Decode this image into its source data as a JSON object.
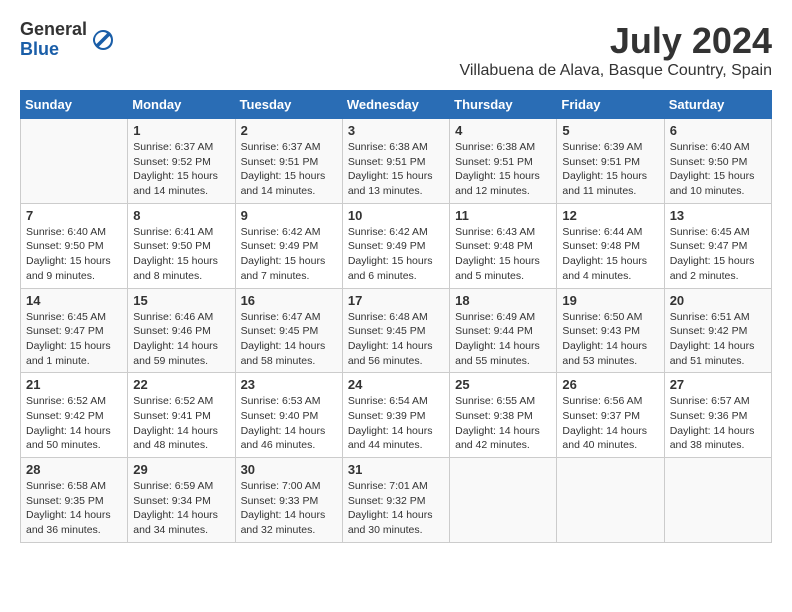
{
  "logo": {
    "general": "General",
    "blue": "Blue"
  },
  "title": "July 2024",
  "location": "Villabuena de Alava, Basque Country, Spain",
  "days_of_week": [
    "Sunday",
    "Monday",
    "Tuesday",
    "Wednesday",
    "Thursday",
    "Friday",
    "Saturday"
  ],
  "weeks": [
    [
      {
        "day": "",
        "info": ""
      },
      {
        "day": "1",
        "info": "Sunrise: 6:37 AM\nSunset: 9:52 PM\nDaylight: 15 hours\nand 14 minutes."
      },
      {
        "day": "2",
        "info": "Sunrise: 6:37 AM\nSunset: 9:51 PM\nDaylight: 15 hours\nand 14 minutes."
      },
      {
        "day": "3",
        "info": "Sunrise: 6:38 AM\nSunset: 9:51 PM\nDaylight: 15 hours\nand 13 minutes."
      },
      {
        "day": "4",
        "info": "Sunrise: 6:38 AM\nSunset: 9:51 PM\nDaylight: 15 hours\nand 12 minutes."
      },
      {
        "day": "5",
        "info": "Sunrise: 6:39 AM\nSunset: 9:51 PM\nDaylight: 15 hours\nand 11 minutes."
      },
      {
        "day": "6",
        "info": "Sunrise: 6:40 AM\nSunset: 9:50 PM\nDaylight: 15 hours\nand 10 minutes."
      }
    ],
    [
      {
        "day": "7",
        "info": "Sunrise: 6:40 AM\nSunset: 9:50 PM\nDaylight: 15 hours\nand 9 minutes."
      },
      {
        "day": "8",
        "info": "Sunrise: 6:41 AM\nSunset: 9:50 PM\nDaylight: 15 hours\nand 8 minutes."
      },
      {
        "day": "9",
        "info": "Sunrise: 6:42 AM\nSunset: 9:49 PM\nDaylight: 15 hours\nand 7 minutes."
      },
      {
        "day": "10",
        "info": "Sunrise: 6:42 AM\nSunset: 9:49 PM\nDaylight: 15 hours\nand 6 minutes."
      },
      {
        "day": "11",
        "info": "Sunrise: 6:43 AM\nSunset: 9:48 PM\nDaylight: 15 hours\nand 5 minutes."
      },
      {
        "day": "12",
        "info": "Sunrise: 6:44 AM\nSunset: 9:48 PM\nDaylight: 15 hours\nand 4 minutes."
      },
      {
        "day": "13",
        "info": "Sunrise: 6:45 AM\nSunset: 9:47 PM\nDaylight: 15 hours\nand 2 minutes."
      }
    ],
    [
      {
        "day": "14",
        "info": "Sunrise: 6:45 AM\nSunset: 9:47 PM\nDaylight: 15 hours\nand 1 minute."
      },
      {
        "day": "15",
        "info": "Sunrise: 6:46 AM\nSunset: 9:46 PM\nDaylight: 14 hours\nand 59 minutes."
      },
      {
        "day": "16",
        "info": "Sunrise: 6:47 AM\nSunset: 9:45 PM\nDaylight: 14 hours\nand 58 minutes."
      },
      {
        "day": "17",
        "info": "Sunrise: 6:48 AM\nSunset: 9:45 PM\nDaylight: 14 hours\nand 56 minutes."
      },
      {
        "day": "18",
        "info": "Sunrise: 6:49 AM\nSunset: 9:44 PM\nDaylight: 14 hours\nand 55 minutes."
      },
      {
        "day": "19",
        "info": "Sunrise: 6:50 AM\nSunset: 9:43 PM\nDaylight: 14 hours\nand 53 minutes."
      },
      {
        "day": "20",
        "info": "Sunrise: 6:51 AM\nSunset: 9:42 PM\nDaylight: 14 hours\nand 51 minutes."
      }
    ],
    [
      {
        "day": "21",
        "info": "Sunrise: 6:52 AM\nSunset: 9:42 PM\nDaylight: 14 hours\nand 50 minutes."
      },
      {
        "day": "22",
        "info": "Sunrise: 6:52 AM\nSunset: 9:41 PM\nDaylight: 14 hours\nand 48 minutes."
      },
      {
        "day": "23",
        "info": "Sunrise: 6:53 AM\nSunset: 9:40 PM\nDaylight: 14 hours\nand 46 minutes."
      },
      {
        "day": "24",
        "info": "Sunrise: 6:54 AM\nSunset: 9:39 PM\nDaylight: 14 hours\nand 44 minutes."
      },
      {
        "day": "25",
        "info": "Sunrise: 6:55 AM\nSunset: 9:38 PM\nDaylight: 14 hours\nand 42 minutes."
      },
      {
        "day": "26",
        "info": "Sunrise: 6:56 AM\nSunset: 9:37 PM\nDaylight: 14 hours\nand 40 minutes."
      },
      {
        "day": "27",
        "info": "Sunrise: 6:57 AM\nSunset: 9:36 PM\nDaylight: 14 hours\nand 38 minutes."
      }
    ],
    [
      {
        "day": "28",
        "info": "Sunrise: 6:58 AM\nSunset: 9:35 PM\nDaylight: 14 hours\nand 36 minutes."
      },
      {
        "day": "29",
        "info": "Sunrise: 6:59 AM\nSunset: 9:34 PM\nDaylight: 14 hours\nand 34 minutes."
      },
      {
        "day": "30",
        "info": "Sunrise: 7:00 AM\nSunset: 9:33 PM\nDaylight: 14 hours\nand 32 minutes."
      },
      {
        "day": "31",
        "info": "Sunrise: 7:01 AM\nSunset: 9:32 PM\nDaylight: 14 hours\nand 30 minutes."
      },
      {
        "day": "",
        "info": ""
      },
      {
        "day": "",
        "info": ""
      },
      {
        "day": "",
        "info": ""
      }
    ]
  ]
}
